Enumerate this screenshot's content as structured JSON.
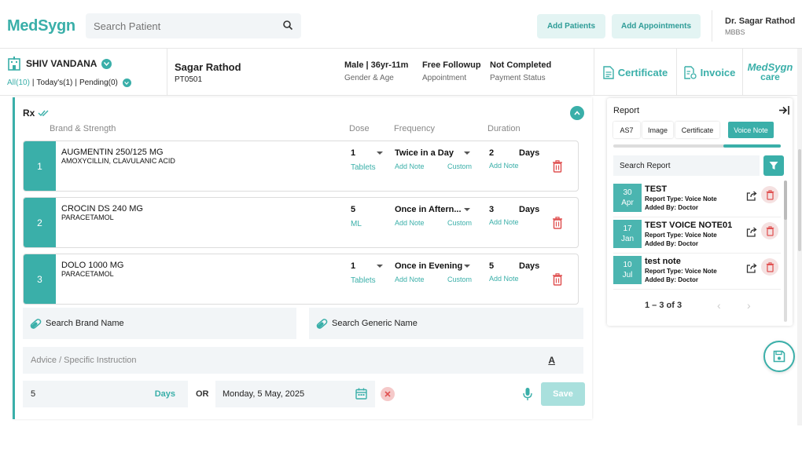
{
  "header": {
    "logo": "MedSygn",
    "search_placeholder": "Search Patient",
    "add_patients": "Add Patients",
    "add_appointments": "Add Appointments",
    "doctor_name": "Dr. Sagar Rathod",
    "doctor_degree": "MBBS"
  },
  "clinic": {
    "name": "SHIV VANDANA",
    "all": "All(10)",
    "todays": "Today's(1)",
    "pending": "Pending(0)",
    "sep": "|"
  },
  "patient": {
    "name": "Sagar Rathod",
    "id": "PT0501",
    "gender_age": "Male | 36yr-11m",
    "gender_age_label": "Gender & Age",
    "appointment": "Free Followup",
    "appointment_label": "Appointment",
    "payment": "Not Completed",
    "payment_label": "Payment Status"
  },
  "actions": {
    "certificate": "Certificate",
    "invoice": "Invoice",
    "care_logo_top": "MedSygn",
    "care_logo_bottom": "care"
  },
  "rx": {
    "title": "Rx",
    "headers": {
      "brand": "Brand & Strength",
      "dose": "Dose",
      "frequency": "Frequency",
      "duration": "Duration"
    },
    "medicines": [
      {
        "num": "1",
        "name": "AUGMENTIN 250/125 MG",
        "generic": "AMOXYCILLIN, CLAVULANIC ACID",
        "dose": "1",
        "dose_unit": "Tablets",
        "frequency": "Twice in a Day",
        "add_note": "Add Note",
        "custom": "Custom",
        "duration": "2",
        "duration_unit": "Days",
        "duration_note": "Add Note"
      },
      {
        "num": "2",
        "name": "CROCIN DS 240 MG",
        "generic": "PARACETAMOL",
        "dose": "5",
        "dose_unit": "ML",
        "frequency": "Once in Aftern...",
        "add_note": "Add Note",
        "custom": "Custom",
        "duration": "3",
        "duration_unit": "Days",
        "duration_note": "Add Note"
      },
      {
        "num": "3",
        "name": "DOLO 1000 MG",
        "generic": "PARACETAMOL",
        "dose": "1",
        "dose_unit": "Tablets",
        "frequency": "Once in Evening",
        "add_note": "Add Note",
        "custom": "Custom",
        "duration": "5",
        "duration_unit": "Days",
        "duration_note": "Add Note"
      }
    ],
    "search_brand": "Search Brand Name",
    "search_generic": "Search Generic Name",
    "advice_placeholder": "Advice / Specific Instruction",
    "advice_icon": "A",
    "followup_value": "5",
    "followup_unit": "Days",
    "or": "OR",
    "followup_date": "Monday, 5 May, 2025",
    "save": "Save"
  },
  "report": {
    "title": "Report",
    "tabs": [
      "AS7",
      "Image",
      "Certificate",
      "Voice Note"
    ],
    "active_tab": "Voice Note",
    "search_placeholder": "Search Report",
    "items": [
      {
        "day": "30",
        "month": "Apr",
        "name": "TEST",
        "type_label": "Report Type:",
        "type": "Voice Note",
        "added_label": "Added By:",
        "added": "Doctor"
      },
      {
        "day": "17",
        "month": "Jan",
        "name": "TEST VOICE NOTE01",
        "type_label": "Report Type:",
        "type": "Voice Note",
        "added_label": "Added By:",
        "added": "Doctor"
      },
      {
        "day": "10",
        "month": "Jul",
        "name": "test note",
        "type_label": "Report Type:",
        "type": "Voice Note",
        "added_label": "Added By:",
        "added": "Doctor"
      }
    ],
    "pager": "1 – 3 of 3"
  },
  "colors": {
    "accent": "#3aafa9",
    "danger": "#e05252"
  }
}
